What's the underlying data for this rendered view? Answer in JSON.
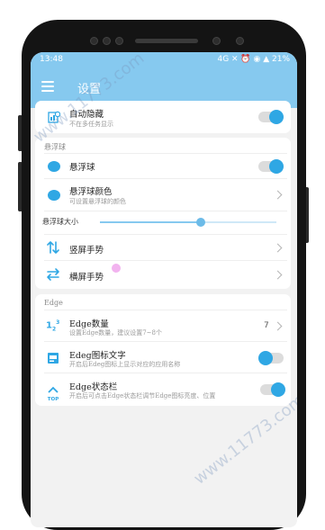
{
  "status_bar": {
    "time": "13:48",
    "right_text": "4G ✕ ⏰ ◉ ▲ 21%"
  },
  "app_bar": {
    "title": "设置"
  },
  "card1": {
    "title": "自动隐藏",
    "subtitle": "不在多任务显示"
  },
  "float_section": {
    "header": "悬浮球",
    "ball_title": "悬浮球",
    "color_title": "悬浮球颜色",
    "color_subtitle": "可设置悬浮球的颜色",
    "size_label": "悬浮球大小",
    "size_level": 0.57,
    "portrait_title": "竖屏手势",
    "landscape_title": "横屏手势"
  },
  "edge_section": {
    "header": "Edge",
    "count_title": "Edge数量",
    "count_subtitle": "设置Edge数量，建议设置7~8个",
    "count_value": "7",
    "text_title": "Edeg图标文字",
    "text_subtitle": "开启后Edeg图标上显示对应的应用名称",
    "status_title": "Edge状态栏",
    "status_subtitle": "开启后可点击Edge状态栏调节Edge图标亮度、位置"
  },
  "watermark": {
    "text": "www.11773.com"
  },
  "colors": {
    "accent": "#2fa7e4",
    "appbar": "#86c9ef"
  }
}
